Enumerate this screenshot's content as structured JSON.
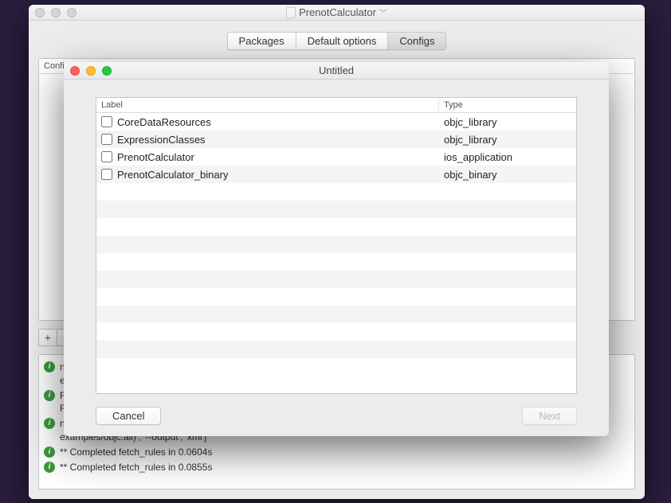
{
  "main_window": {
    "title": "PrenotCalculator",
    "tabs": [
      {
        "label": "Packages",
        "selected": false
      },
      {
        "label": "Default options",
        "selected": false
      },
      {
        "label": "Configs",
        "selected": true
      }
    ],
    "config_table": {
      "header": "Config"
    },
    "add_label": "+",
    "remove_label": "−",
    "logs": [
      {
        "icon": "info",
        "text": "n…\ne…"
      },
      {
        "icon": "info",
        "text": "F…\nR…"
      },
      {
        "icon": "info",
        "text": "n…\nexamples/objc:all)', '--output', 'xml']"
      },
      {
        "icon": "info",
        "text": "** Completed fetch_rules in 0.0604s"
      },
      {
        "icon": "info",
        "text": "** Completed fetch_rules in 0.0855s"
      }
    ]
  },
  "sheet": {
    "title": "Untitled",
    "columns": {
      "label": "Label",
      "type": "Type"
    },
    "rows": [
      {
        "label": "CoreDataResources",
        "type": "objc_library",
        "checked": false
      },
      {
        "label": "ExpressionClasses",
        "type": "objc_library",
        "checked": false
      },
      {
        "label": "PrenotCalculator",
        "type": "ios_application",
        "checked": false
      },
      {
        "label": "PrenotCalculator_binary",
        "type": "objc_binary",
        "checked": false
      }
    ],
    "cancel_label": "Cancel",
    "next_label": "Next"
  }
}
